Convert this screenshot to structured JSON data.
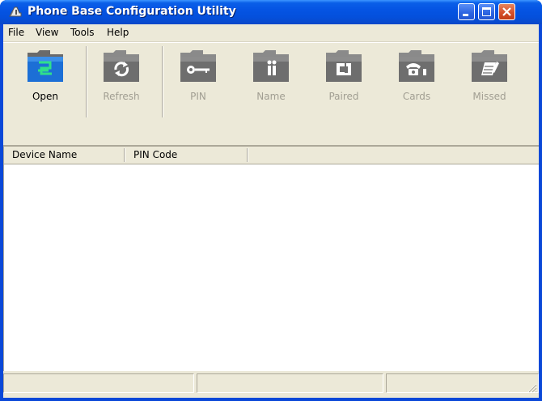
{
  "window": {
    "title": "Phone Base Configuration Utility",
    "title_bar_color": "#0a5fe8",
    "close_button_color": "#d6502b"
  },
  "menu": {
    "items": [
      "File",
      "View",
      "Tools",
      "Help"
    ]
  },
  "toolbar": {
    "buttons": [
      {
        "label": "Open",
        "icon": "open-icon",
        "enabled": true
      },
      {
        "label": "Refresh",
        "icon": "refresh-icon",
        "enabled": false
      },
      {
        "label": "PIN",
        "icon": "key-icon",
        "enabled": false
      },
      {
        "label": "Name",
        "icon": "name-icon",
        "enabled": false
      },
      {
        "label": "Paired",
        "icon": "paired-icon",
        "enabled": false
      },
      {
        "label": "Cards",
        "icon": "phone-icon",
        "enabled": false
      },
      {
        "label": "Missed",
        "icon": "notepad-icon",
        "enabled": false
      }
    ],
    "accent_color": "#1f8a4c"
  },
  "list": {
    "columns": [
      "Device Name",
      "PIN Code"
    ],
    "rows": []
  },
  "status": {
    "panels": [
      "",
      "",
      ""
    ]
  }
}
